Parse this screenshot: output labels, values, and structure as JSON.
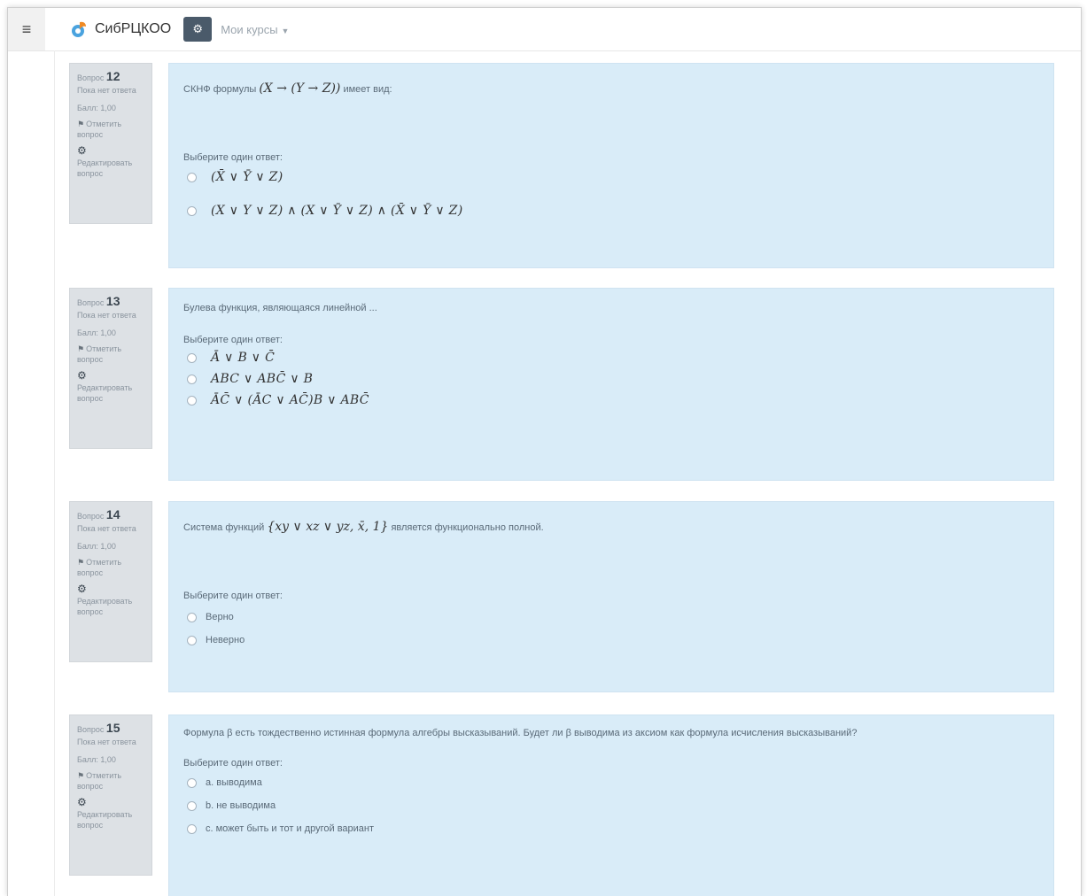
{
  "app": {
    "brand": "СибРЦКОО",
    "my_courses": "Мои курсы"
  },
  "question_meta": {
    "label": "Вопрос",
    "status": "Пока нет ответа",
    "score": "Балл: 1,00",
    "flag": "Отметить вопрос",
    "edit": "Редактировать вопрос"
  },
  "questions": [
    {
      "number": "12",
      "text_before": "СКНФ формулы",
      "text_math": "(X → (Y → Z))",
      "text_after": "имеет вид:",
      "prompt": "Выберите один ответ:",
      "options": [
        "(X̄ ∨ Ȳ ∨ Z)",
        "(X ∨ Y ∨ Z) ∧ (X ∨ Ȳ ∨ Z) ∧ (X̄ ∨ Ȳ ∨ Z)"
      ]
    },
    {
      "number": "13",
      "text_before": "Булева функция, являющаяся линейной ...",
      "prompt": "Выберите один ответ:",
      "options": [
        "Ā ∨ B ∨ C̄",
        "ABC ∨ ABC̄ ∨ B",
        "ĀC̄ ∨ (ĀC ∨ AC̄)B ∨ ABC̄"
      ]
    },
    {
      "number": "14",
      "text_before": "Система функций",
      "text_math": "{xy ∨ xz ∨ yz, x̄, 1}",
      "text_after": "является функционально полной.",
      "prompt": "Выберите один ответ:",
      "options": [
        "Верно",
        "Неверно"
      ]
    },
    {
      "number": "15",
      "text_before": "Формула β есть тождественно истинная формула алгебры высказываний. Будет ли β выводима из аксиом как формула исчисления высказываний?",
      "prompt": "Выберите один ответ:",
      "options": [
        "a. выводима",
        "b. не выводима",
        "c. может быть и тот и другой вариант"
      ]
    }
  ]
}
